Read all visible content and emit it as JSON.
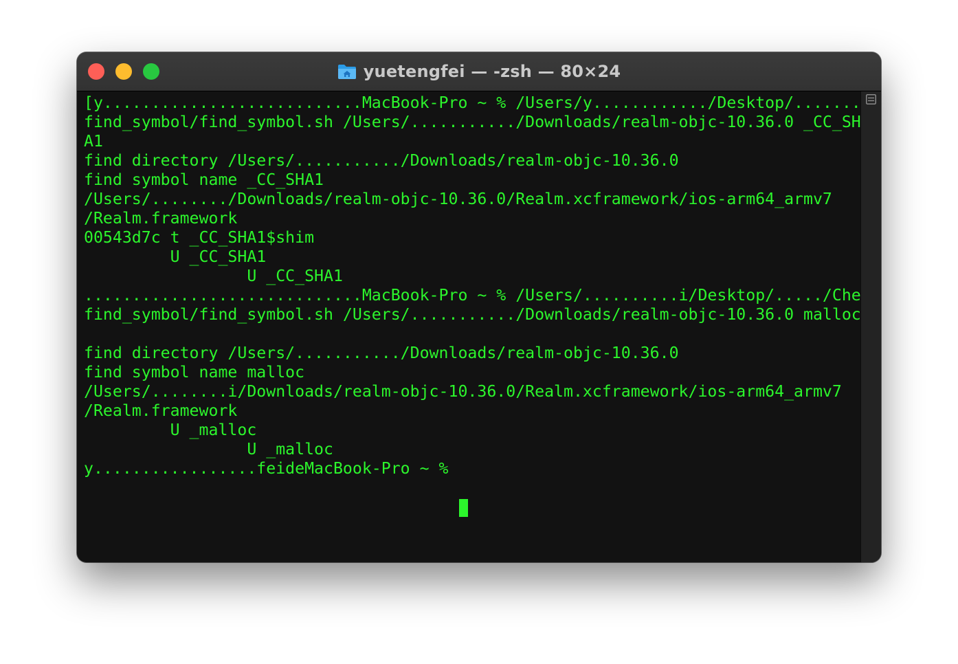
{
  "window": {
    "title": "yuetengfei — -zsh — 80×24"
  },
  "terminal": {
    "lines": [
      "[y...........................MacBook-Pro ~ % /Users/y............/Desktop/..................../]",
      "find_symbol/find_symbol.sh /Users/.........../Downloads/realm-objc-10.36.0 _CC_SH",
      "A1",
      "find directory /Users/.........../Downloads/realm-objc-10.36.0",
      "find symbol name _CC_SHA1",
      "/Users/......../Downloads/realm-objc-10.36.0/Realm.xcframework/ios-arm64_armv7",
      "/Realm.framework",
      "00543d7c t _CC_SHA1$shim",
      "         U _CC_SHA1",
      "                 U _CC_SHA1",
      ".............................MacBook-Pro ~ % /Users/..........i/Desktop/...../CheckDemo/",
      "find_symbol/find_symbol.sh /Users/.........../Downloads/realm-objc-10.36.0 malloc",
      "",
      "find directory /Users/.........../Downloads/realm-objc-10.36.0",
      "find symbol name malloc",
      "/Users/........i/Downloads/realm-objc-10.36.0/Realm.xcframework/ios-arm64_armv7",
      "/Realm.framework",
      "         U _malloc",
      "                 U _malloc",
      "y.................feideMacBook-Pro ~ % "
    ]
  },
  "colors": {
    "terminal_text": "#2cf52c",
    "terminal_bg": "#121212",
    "titlebar": "#363636",
    "close": "#fe5f57",
    "minimize": "#febc2e",
    "maximize": "#28c840"
  },
  "icons": {
    "title_icon": "folder-home-icon",
    "scrollbar_icon": "split-pane-icon"
  }
}
